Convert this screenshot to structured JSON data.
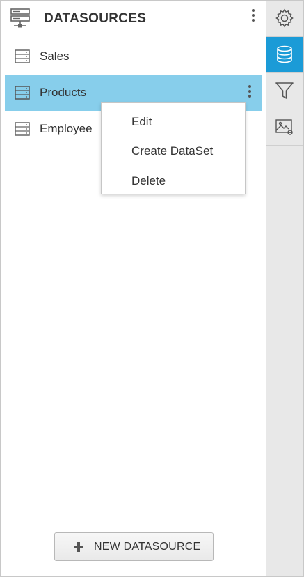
{
  "panel": {
    "title": "DATASOURCES",
    "header_icon": "server-icon",
    "more_icon": "kebab-menu-icon"
  },
  "datasources": [
    {
      "label": "Sales",
      "icon": "datasource-icon",
      "selected": false
    },
    {
      "label": "Products",
      "icon": "datasource-icon",
      "selected": true
    },
    {
      "label": "Employee",
      "icon": "datasource-icon",
      "selected": false
    }
  ],
  "context_menu": {
    "items": [
      "Edit",
      "Create DataSet",
      "Delete"
    ]
  },
  "new_datasource_button": {
    "label": "NEW DATASOURCE",
    "icon": "plus-icon"
  },
  "toolbar": {
    "items": [
      {
        "icon": "gear-icon",
        "active": false
      },
      {
        "icon": "database-icon",
        "active": true
      },
      {
        "icon": "filter-icon",
        "active": false
      },
      {
        "icon": "image-settings-icon",
        "active": false
      }
    ]
  },
  "colors": {
    "selected_row": "#87ceeb",
    "active_tool": "#1b9bd7",
    "toolbar_bg": "#e8e8e8",
    "text": "#333333"
  }
}
